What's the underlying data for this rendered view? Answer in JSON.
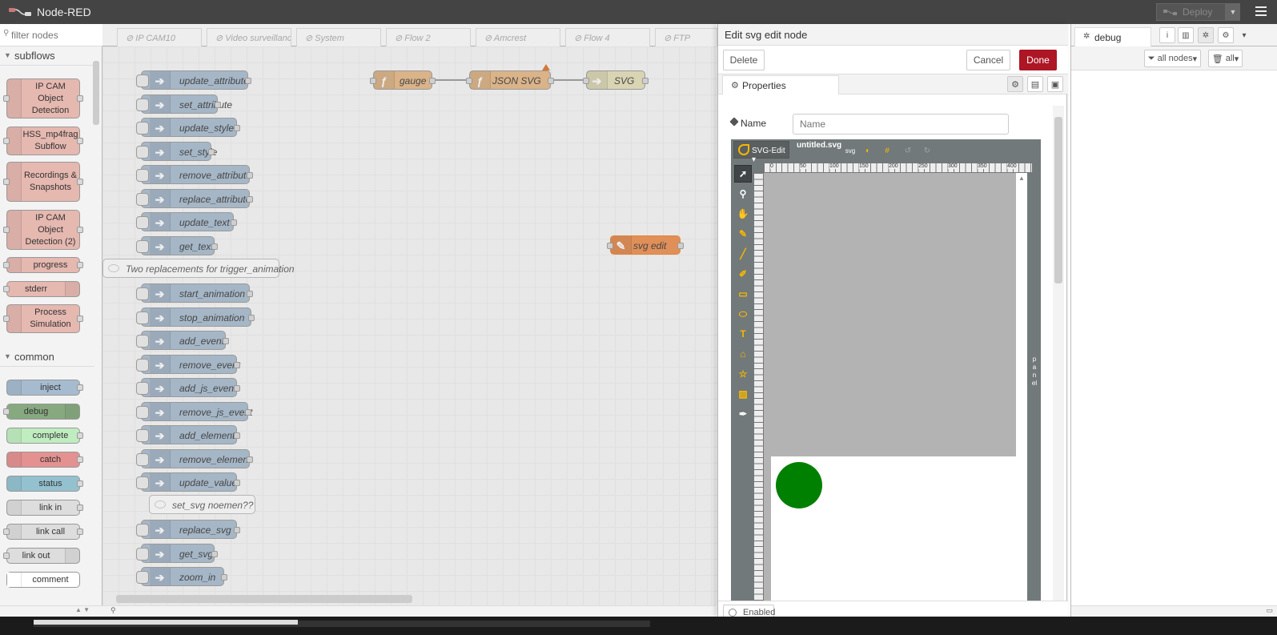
{
  "header": {
    "app_title": "Node-RED",
    "deploy_label": "Deploy"
  },
  "palette": {
    "filter_placeholder": "filter nodes",
    "categories": [
      {
        "name": "subflows",
        "items": [
          {
            "label": "IP CAM Object Detection"
          },
          {
            "label": "HSS_mp4frag Subflow"
          },
          {
            "label": "Recordings & Snapshots"
          },
          {
            "label": "IP CAM Object Detection (2)"
          },
          {
            "label": "progress"
          },
          {
            "label": "stderr"
          },
          {
            "label": "Process Simulation"
          }
        ]
      },
      {
        "name": "common",
        "items": [
          {
            "label": "inject"
          },
          {
            "label": "debug"
          },
          {
            "label": "complete"
          },
          {
            "label": "catch"
          },
          {
            "label": "status"
          },
          {
            "label": "link in"
          },
          {
            "label": "link call"
          },
          {
            "label": "link out"
          },
          {
            "label": "comment"
          }
        ]
      }
    ]
  },
  "workspace": {
    "tabs": [
      "IP CAM10",
      "Video surveillanc",
      "System",
      "Flow 2",
      "Amcrest",
      "Flow 4",
      "FTP"
    ],
    "nodes": [
      "update_attribute",
      "set_attribute",
      "update_style",
      "set_style",
      "remove_attribute",
      "replace_attribute",
      "update_text",
      "get_text",
      "start_animation",
      "stop_animation",
      "add_event",
      "remove_event",
      "add_js_event",
      "remove_js_event",
      "add_element",
      "remove_element",
      "update_value",
      "replace_svg",
      "get_svg",
      "zoom_in"
    ],
    "comment_1": "Two replacements for trigger_animation",
    "comment_2": "set_svg noemen??",
    "flow_nodes": {
      "gauge": "gauge",
      "json_svg": "JSON SVG",
      "svg": "SVG",
      "svg_edit": "svg edit"
    }
  },
  "editor": {
    "title": "Edit svg edit node",
    "delete_label": "Delete",
    "cancel_label": "Cancel",
    "done_label": "Done",
    "properties_tab": "Properties",
    "name_label": "Name",
    "name_placeholder": "Name",
    "svgedit": {
      "menu_label": "SVG-Edit",
      "file_name": "untitled.svg",
      "svg_button": "svg",
      "ruler_ticks": [
        "0",
        "50",
        "100",
        "150",
        "200",
        "250",
        "300",
        "350",
        "400"
      ],
      "panel_label": "panel",
      "shape_color": "#008000"
    },
    "enabled_label": "Enabled"
  },
  "sidebar": {
    "debug_tab": "debug",
    "filter_nodes": "all nodes",
    "filter_clear": "all"
  },
  "colors": {
    "header": "#444444",
    "done": "#ad1625",
    "svgedit_accent": "#f5b700"
  }
}
